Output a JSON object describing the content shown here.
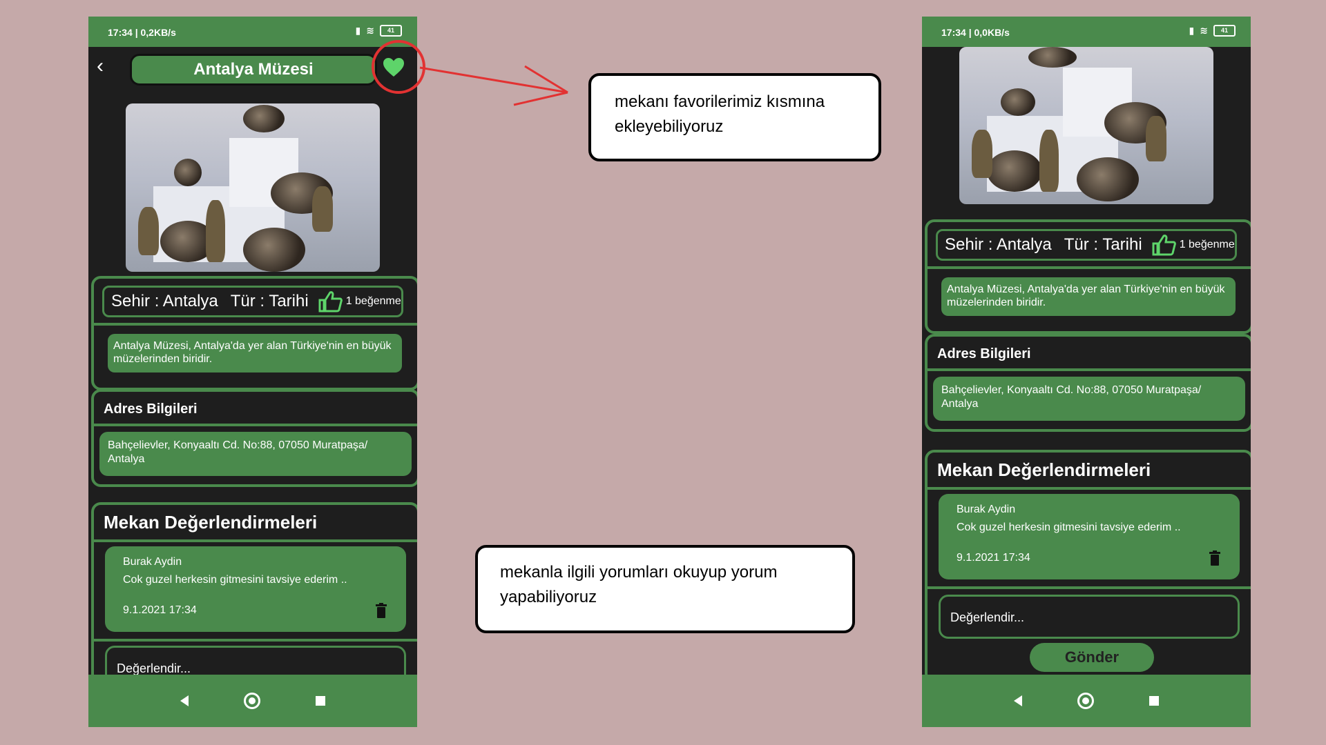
{
  "status_left": {
    "time": "17:34 | 0,2KB/s",
    "battery": "41"
  },
  "status_right": {
    "time": "17:34 | 0,0KB/s",
    "battery": "41"
  },
  "app": {
    "title": "Antalya Müzesi",
    "city": "Sehir : Antalya",
    "type": "Tür : Tarihi",
    "likes": "1 beğenme",
    "description": "Antalya Müzesi, Antalya'da yer alan Türkiye'nin en büyük müzelerinden biridir.",
    "address_title": "Adres Bilgileri",
    "address": "Bahçelievler, Konyaaltı Cd. No:88, 07050 Muratpaşa/ Antalya",
    "reviews_title": "Mekan Değerlendirmeleri",
    "review": {
      "author": "Burak Aydin",
      "text": "Cok guzel herkesin gitmesini tavsiye ederim ..",
      "date": "9.1.2021 17:34"
    },
    "rate_placeholder": "Değerlendir...",
    "send_label": "Gönder"
  },
  "notes": {
    "favorites": "mekanı favorilerimiz kısmına ekleyebiliyoruz",
    "comments": "mekanla ilgili yorumları okuyup yorum yapabiliyoruz"
  },
  "colors": {
    "background": "#c5a9a9",
    "app_green": "#4a8a4c",
    "dark": "#1e1e1e",
    "heart": "#5ed46a",
    "callout_red": "#e23232"
  },
  "icons": [
    "back-chevron-icon",
    "heart-icon",
    "thumbs-up-icon",
    "trash-icon",
    "nav-back-icon",
    "nav-home-icon",
    "nav-recent-icon"
  ]
}
